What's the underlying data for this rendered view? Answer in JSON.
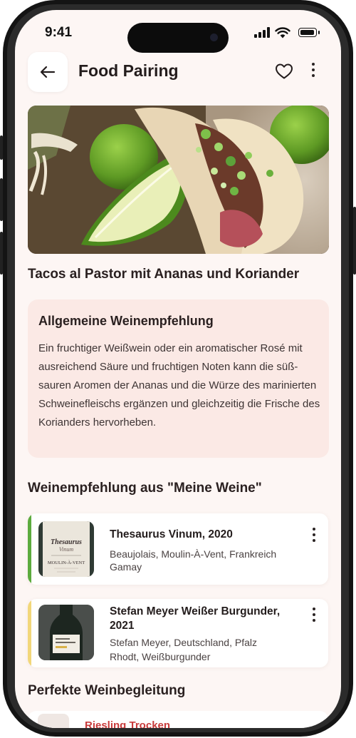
{
  "status_bar": {
    "time": "9:41"
  },
  "header": {
    "title": "Food Pairing"
  },
  "dish": {
    "title": "Tacos al Pastor mit Ananas und Koriander"
  },
  "general_recommendation": {
    "title": "Allgemeine Weinempfehlung",
    "text": "Ein fruchtiger Weißwein oder ein aromatischer Rosé mit ausreichend Säure und fruchtigen Noten kann die süß-sauren Aromen der Ananas und die Würze des marinierten Schweinefleischs ergänzen und gleichzeitig die Frische des Korianders hervorheben."
  },
  "my_wines_section": {
    "title": "Weinempfehlung aus \"Meine Weine\""
  },
  "wines": [
    {
      "name": "Thesaurus Vinum, 2020",
      "region": "Beaujolais, Moulin-À-Vent, Frankreich",
      "grape": "Gamay",
      "accent_color": "#5cab3e",
      "label_brand": "Thesaurus",
      "label_sub": "Vinum",
      "label_place": "MOULIN-À-VENT"
    },
    {
      "name": "Stefan Meyer Weißer Burgunder, 2021",
      "region": "Stefan Meyer, Deutschland, Pfalz",
      "grape": "Rhodt, Weißburgunder",
      "accent_color": "#f2d77a"
    }
  ],
  "perfect_section": {
    "title": "Perfekte Weinbegleitung"
  },
  "next_item": {
    "name": "Riesling Trocken"
  },
  "colors": {
    "background": "#fdf6f4",
    "recommendation_box": "#fbe9e5",
    "accent_red": "#c83b3b"
  },
  "icons": [
    "back-arrow-icon",
    "heart-icon",
    "more-vertical-icon",
    "signal-icon",
    "wifi-icon",
    "battery-icon"
  ]
}
